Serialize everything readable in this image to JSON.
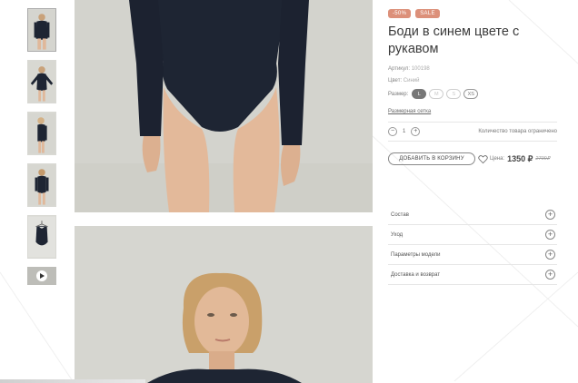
{
  "product": {
    "badges": [
      "-50%",
      "SALE"
    ],
    "title": "Боди в синем цвете с рукавом",
    "article_label": "Артикул:",
    "article_value": "100198",
    "color_label": "Цвет:",
    "color_value": "Синий",
    "size_label": "Размер:",
    "sizes": [
      {
        "label": "L",
        "state": "selected"
      },
      {
        "label": "M",
        "state": "unavailable"
      },
      {
        "label": "S",
        "state": "unavailable"
      },
      {
        "label": "XS",
        "state": "available"
      }
    ],
    "size_chart_link": "Размерная сетка",
    "quantity": "1",
    "quantity_note": "Количество товара ограничено",
    "add_to_cart": "ДОБАВИТЬ В КОРЗИНУ",
    "price_label": "Цена:",
    "price": "1350 ₽",
    "old_price": "2700₽"
  },
  "accordion": [
    {
      "label": "Состав"
    },
    {
      "label": "Уход"
    },
    {
      "label": "Параметры модели"
    },
    {
      "label": "Доставка и возврат"
    }
  ],
  "gallery": {
    "thumbnails": [
      "photo-front-icon",
      "photo-arms-icon",
      "photo-side-icon",
      "photo-back-icon",
      "photo-hanger-icon",
      "play-video-icon"
    ]
  },
  "colors": {
    "badge": "#dc907a",
    "garment": "#1e2533",
    "background": "#d3d3cd"
  }
}
